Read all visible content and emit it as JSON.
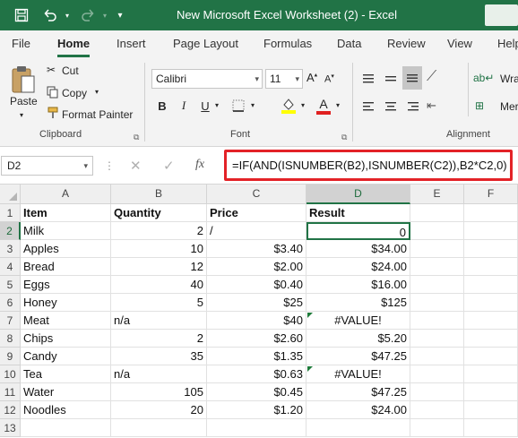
{
  "window": {
    "title": "New Microsoft Excel Worksheet (2)  -  Excel",
    "accent": "#217346"
  },
  "quick_access": {
    "save_icon": "save-icon",
    "undo_icon": "undo-icon",
    "redo_icon": "redo-icon",
    "customize_icon": "customize-qat-icon"
  },
  "ribbon_tabs": [
    "File",
    "Home",
    "Insert",
    "Page Layout",
    "Formulas",
    "Data",
    "Review",
    "View",
    "Help"
  ],
  "active_tab": "Home",
  "clipboard": {
    "paste": "Paste",
    "cut": "Cut",
    "copy": "Copy",
    "format_painter": "Format Painter",
    "group_label": "Clipboard"
  },
  "font": {
    "name": "Calibri",
    "size": "11",
    "bold": "B",
    "italic": "I",
    "underline": "U",
    "font_color": "A",
    "group_label": "Font"
  },
  "alignment": {
    "wrap": "Wra",
    "merge": "Mer",
    "group_label": "Alignment"
  },
  "formula_bar": {
    "name_box": "D2",
    "fx": "fx",
    "formula": "=IF(AND(ISNUMBER(B2),ISNUMBER(C2)),B2*C2,0)",
    "highlight_color": "#e32227"
  },
  "sheet": {
    "columns": [
      "A",
      "B",
      "C",
      "D",
      "E",
      "F"
    ],
    "selected_column": "D",
    "selected_row": "2",
    "rows": [
      {
        "n": "1",
        "a": "Item",
        "b": "Quantity",
        "c": "Price",
        "d": "Result"
      },
      {
        "n": "2",
        "a": "Milk",
        "b": "2",
        "c": "/",
        "d": "0"
      },
      {
        "n": "3",
        "a": "Apples",
        "b": "10",
        "c": "$3.40",
        "d": "$34.00"
      },
      {
        "n": "4",
        "a": "Bread",
        "b": "12",
        "c": "$2.00",
        "d": "$24.00"
      },
      {
        "n": "5",
        "a": "Eggs",
        "b": "40",
        "c": "$0.40",
        "d": "$16.00"
      },
      {
        "n": "6",
        "a": "Honey",
        "b": "5",
        "c": "$25",
        "d": "$125"
      },
      {
        "n": "7",
        "a": "Meat",
        "b": "n/a",
        "c": "$40",
        "d": "#VALUE!"
      },
      {
        "n": "8",
        "a": "Chips",
        "b": "2",
        "c": "$2.60",
        "d": "$5.20"
      },
      {
        "n": "9",
        "a": "Candy",
        "b": "35",
        "c": "$1.35",
        "d": "$47.25"
      },
      {
        "n": "10",
        "a": "Tea",
        "b": "n/a",
        "c": "$0.63",
        "d": "#VALUE!"
      },
      {
        "n": "11",
        "a": "Water",
        "b": "105",
        "c": "$0.45",
        "d": "$47.25"
      },
      {
        "n": "12",
        "a": "Noodles",
        "b": "20",
        "c": "$1.20",
        "d": "$24.00"
      },
      {
        "n": "13",
        "a": "",
        "b": "",
        "c": "",
        "d": ""
      }
    ]
  }
}
